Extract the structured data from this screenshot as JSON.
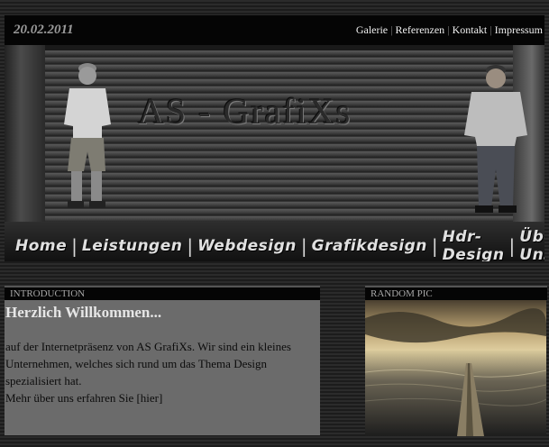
{
  "header": {
    "date": "20.02.2011",
    "top_nav": [
      "Galerie",
      "Referenzen",
      "Kontakt",
      "Impressum"
    ]
  },
  "banner": {
    "logo_text": "AS - GrafiXs"
  },
  "main_nav": [
    "Home",
    "Leistungen",
    "Webdesign",
    "Grafikdesign",
    "Hdr-Design",
    "Über Uns"
  ],
  "intro": {
    "header": "INTRODUCTION",
    "title": "Herzlich Willkommen...",
    "lines": [
      "auf der Internetpräsenz von AS GrafiXs. Wir sind ein kleines Unternehmen, welches sich rund um das Thema Design spezialisiert hat.",
      "Mehr über uns erfahren Sie [hier]"
    ]
  },
  "random_pic": {
    "header": "RANDOM PIC"
  }
}
